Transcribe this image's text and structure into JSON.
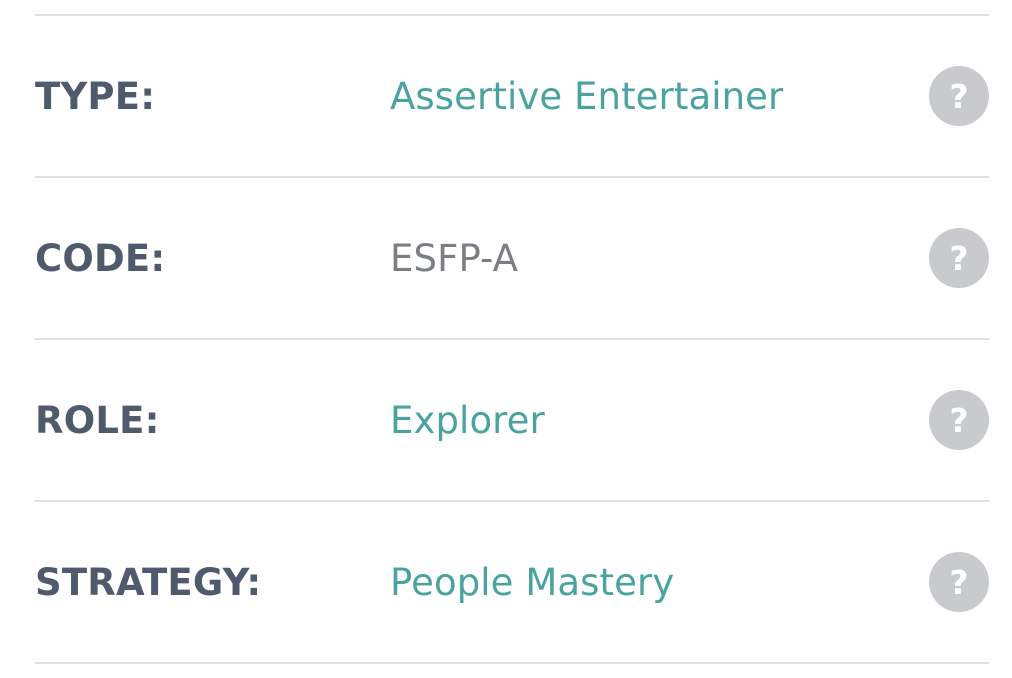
{
  "rows": [
    {
      "label": "TYPE:",
      "value": "Assertive Entertainer",
      "value_style": "link",
      "help_icon": "question-mark-icon",
      "help_glyph": "?"
    },
    {
      "label": "CODE:",
      "value": "ESFP-A",
      "value_style": "plain",
      "help_icon": "question-mark-icon",
      "help_glyph": "?"
    },
    {
      "label": "ROLE:",
      "value": "Explorer",
      "value_style": "link",
      "help_icon": "question-mark-icon",
      "help_glyph": "?"
    },
    {
      "label": "STRATEGY:",
      "value": "People Mastery",
      "value_style": "link",
      "help_icon": "question-mark-icon",
      "help_glyph": "?"
    }
  ],
  "colors": {
    "label": "#4f5b6d",
    "link_value": "#4aa39f",
    "plain_value": "#7b7f83",
    "help_bg": "#c8cacd",
    "divider": "#dfe1e3"
  }
}
